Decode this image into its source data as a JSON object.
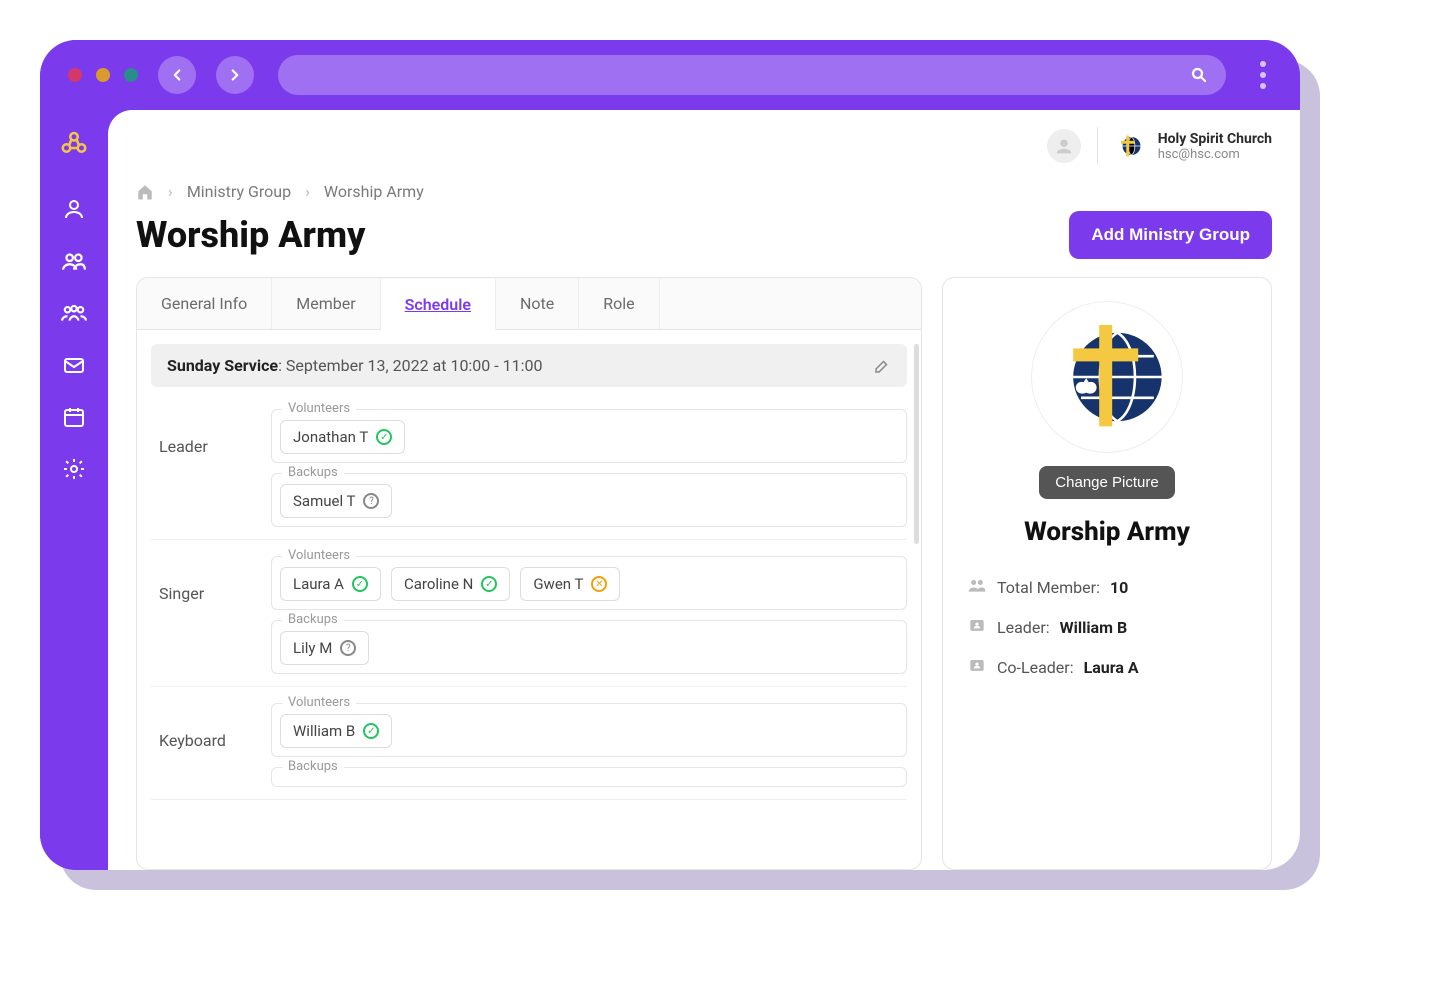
{
  "header": {
    "org_name": "Holy Spirit Church",
    "org_email": "hsc@hsc.com"
  },
  "breadcrumb": {
    "level1": "Ministry Group",
    "level2": "Worship Army"
  },
  "page_title": "Worship Army",
  "add_button": "Add Ministry Group",
  "tabs": {
    "general": "General Info",
    "member": "Member",
    "schedule": "Schedule",
    "note": "Note",
    "role": "Role"
  },
  "schedule": {
    "service_label": "Sunday Service",
    "service_time": "September 13, 2022 at 10:00 - 11:00",
    "labels": {
      "volunteers": "Volunteers",
      "backups": "Backups"
    },
    "roles": [
      {
        "name": "Leader",
        "volunteers": [
          {
            "name": "Jonathan T",
            "status": "ok"
          }
        ],
        "backups": [
          {
            "name": "Samuel T",
            "status": "q"
          }
        ]
      },
      {
        "name": "Singer",
        "volunteers": [
          {
            "name": "Laura A",
            "status": "ok"
          },
          {
            "name": "Caroline N",
            "status": "ok"
          },
          {
            "name": "Gwen T",
            "status": "x"
          }
        ],
        "backups": [
          {
            "name": "Lily M",
            "status": "q"
          }
        ]
      },
      {
        "name": "Keyboard",
        "volunteers": [
          {
            "name": "William B",
            "status": "ok"
          }
        ],
        "backups": []
      }
    ]
  },
  "side_panel": {
    "change_picture": "Change Picture",
    "group_name": "Worship Army",
    "total_label": "Total Member:",
    "total_value": "10",
    "leader_label": "Leader:",
    "leader_value": "William B",
    "coleader_label": "Co-Leader:",
    "coleader_value": "Laura A"
  }
}
